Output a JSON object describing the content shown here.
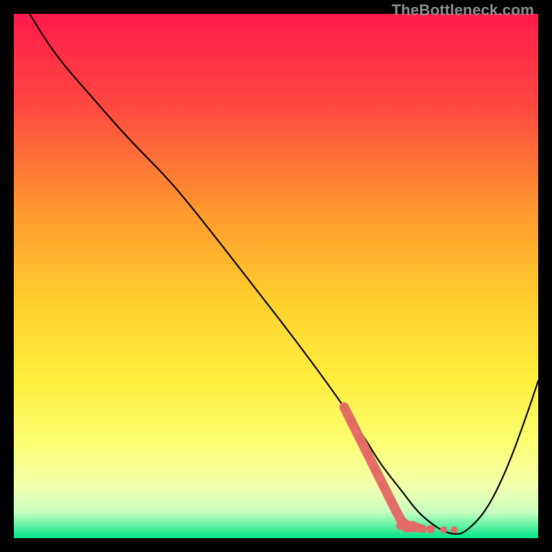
{
  "watermark": "TheBottleneck.com",
  "chart_data": {
    "type": "line",
    "title": "",
    "xlabel": "",
    "ylabel": "",
    "xlim": [
      0,
      100
    ],
    "ylim": [
      0,
      100
    ],
    "grid": false,
    "legend": false,
    "background_gradient": {
      "top_color": "#ff1a4b",
      "mid_colors": [
        "#ff6a3a",
        "#ffb22e",
        "#ffe92e",
        "#fdff5c",
        "#d6ffb0"
      ],
      "bottom_color": "#00e58a"
    },
    "curve": {
      "description": "Bottleneck-style V curve",
      "x": [
        3,
        8,
        15,
        22,
        30,
        38,
        45,
        52,
        58,
        63,
        67,
        70,
        74,
        77,
        80,
        82,
        84,
        86,
        90,
        94,
        98,
        100
      ],
      "y": [
        100,
        92,
        84,
        76,
        68,
        58,
        49,
        40,
        32,
        25,
        19,
        14,
        9,
        5,
        2.5,
        1.3,
        0.7,
        1.0,
        5,
        13,
        24,
        30
      ]
    },
    "markers": {
      "description": "Dashed/dot red markers near trough",
      "color": "#e46a66",
      "points": [
        {
          "x": 63,
          "y": 25
        },
        {
          "x": 64.5,
          "y": 22
        },
        {
          "x": 66,
          "y": 19
        },
        {
          "x": 67.5,
          "y": 16
        },
        {
          "x": 69,
          "y": 13
        },
        {
          "x": 70.5,
          "y": 10
        },
        {
          "x": 72,
          "y": 7
        },
        {
          "x": 73,
          "y": 5
        },
        {
          "x": 74,
          "y": 3.2
        },
        {
          "x": 75,
          "y": 2.4
        },
        {
          "x": 76,
          "y": 2.0
        },
        {
          "x": 78,
          "y": 1.8
        },
        {
          "x": 79.5,
          "y": 1.7
        },
        {
          "x": 82,
          "y": 1.6
        },
        {
          "x": 84,
          "y": 1.6
        }
      ]
    }
  }
}
